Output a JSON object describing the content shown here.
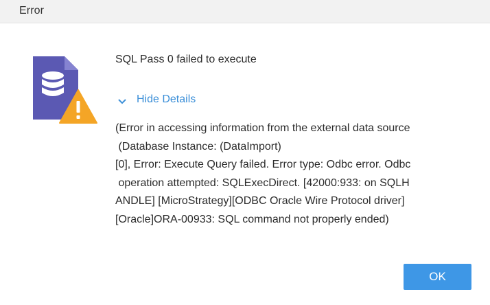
{
  "dialog": {
    "title": "Error",
    "message": "SQL Pass 0 failed to execute",
    "toggle_label": "Hide Details",
    "toggle_icon": "chevron-down-icon",
    "main_icon": "database-warning-icon",
    "details_lines": [
      "(Error in accessing information from the external data source",
      " (Database Instance: (DataImport)",
      "[0], Error: Execute Query failed. Error type: Odbc error. Odbc",
      " operation attempted: SQLExecDirect. [42000:933: on SQLH",
      "ANDLE] [MicroStrategy][ODBC Oracle Wire Protocol driver]",
      "[Oracle]ORA-00933: SQL command not properly ended)"
    ],
    "ok_label": "OK"
  },
  "colors": {
    "titlebar_bg": "#f2f2f2",
    "accent_link": "#3b8fd8",
    "button_bg": "#3e97e6",
    "doc_icon": "#5b59b3",
    "warning_icon": "#f4a526"
  }
}
